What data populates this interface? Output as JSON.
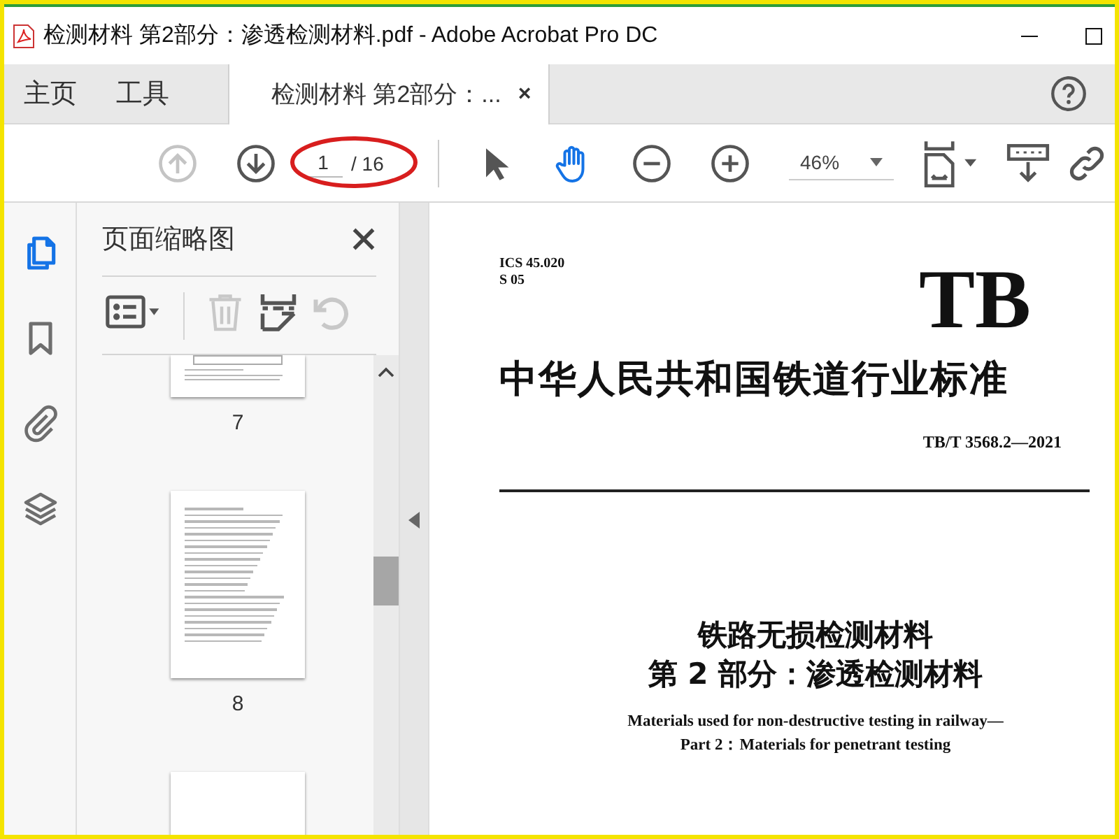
{
  "window": {
    "title": "检测材料 第2部分：渗透检测材料.pdf - Adobe Acrobat Pro DC"
  },
  "tabs": [
    {
      "label": "主页",
      "selected": false
    },
    {
      "label": "工具",
      "selected": false
    },
    {
      "label": "检测材料 第2部分：...",
      "selected": true,
      "close": "×"
    }
  ],
  "toolbar": {
    "nav": [
      {
        "kind": "prev",
        "disabled": true
      },
      {
        "kind": "next",
        "disabled": false
      }
    ],
    "page": {
      "value": "1",
      "total": "/ 16",
      "highlighted": true
    },
    "tools": [
      {
        "kind": "select",
        "selected": false
      },
      {
        "kind": "hand",
        "selected": true
      }
    ],
    "zoom": "46%"
  },
  "sidebar": {
    "items": [
      {
        "kind": "pages",
        "selected": true
      },
      {
        "kind": "bookmark",
        "selected": false
      },
      {
        "kind": "attachment",
        "selected": false
      },
      {
        "kind": "layers",
        "selected": false
      }
    ]
  },
  "panel": {
    "title": "页面缩略图",
    "tools": [
      {
        "kind": "options",
        "disabled": false
      },
      {
        "kind": "delete",
        "disabled": true
      },
      {
        "kind": "insert",
        "disabled": false
      },
      {
        "kind": "rotate",
        "disabled": true
      }
    ],
    "thumbnails": [
      {
        "kind": "tail",
        "page": "7"
      },
      {
        "kind": "full",
        "page": "8"
      },
      {
        "kind": "head"
      }
    ]
  },
  "document": {
    "ics": "ICS 45.020",
    "class": "S 05",
    "logo": "TB",
    "standard": "中华人民共和国铁道行业标准",
    "code": "TB/T 3568.2—2021",
    "title_cn": [
      "铁路无损检测材料",
      "第 2 部分：渗透检测材料"
    ],
    "title_en": [
      "Materials used for non-destructive testing in railway—",
      "Part 2：Materials for penetrant testing"
    ]
  }
}
